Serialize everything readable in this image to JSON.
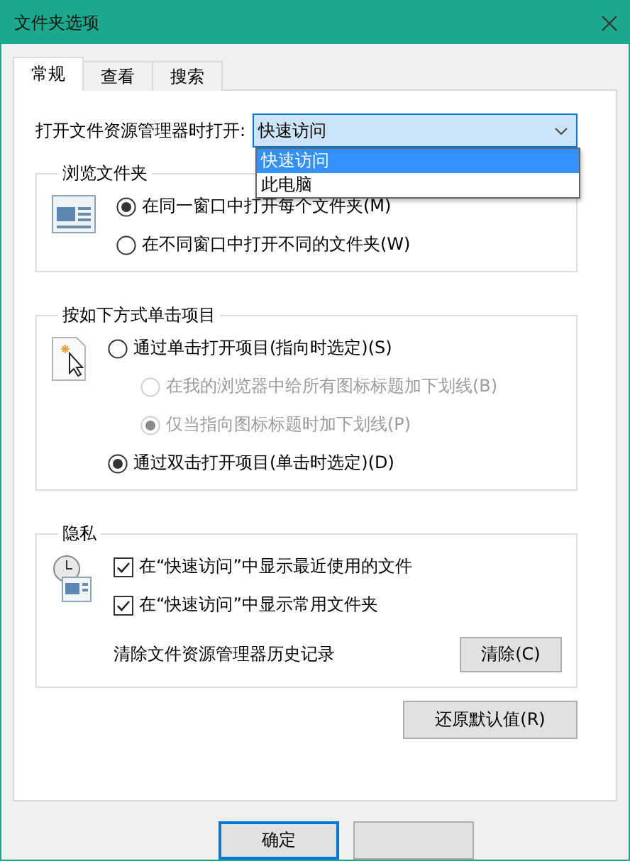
{
  "window": {
    "title": "文件夹选项"
  },
  "tabs": [
    {
      "label": "常规",
      "selected": true
    },
    {
      "label": "查看",
      "selected": false
    },
    {
      "label": "搜索",
      "selected": false
    }
  ],
  "open_with": {
    "label": "打开文件资源管理器时打开:",
    "value": "快速访问",
    "expanded": true,
    "options": [
      {
        "label": "快速访问",
        "selected": true
      },
      {
        "label": "此电脑",
        "selected": false
      }
    ]
  },
  "groups": [
    {
      "title": "浏览文件夹",
      "items": [
        {
          "kind": "radio",
          "label": "在同一窗口中打开每个文件夹(M)",
          "selected": true,
          "disabled": false
        },
        {
          "kind": "radio",
          "label": "在不同窗口中打开不同的文件夹(W)",
          "selected": false,
          "disabled": false
        }
      ]
    },
    {
      "title": "按如下方式单击项目",
      "items": [
        {
          "kind": "radio",
          "label": "通过单击打开项目(指向时选定)(S)",
          "selected": false,
          "disabled": false,
          "children": [
            {
              "kind": "radio",
              "label": "在我的浏览器中给所有图标标题加下划线(B)",
              "selected": false,
              "disabled": true
            },
            {
              "kind": "radio",
              "label": "仅当指向图标标题时加下划线(P)",
              "selected": true,
              "disabled": true
            }
          ]
        },
        {
          "kind": "radio",
          "label": "通过双击打开项目(单击时选定)(D)",
          "selected": true,
          "disabled": false
        }
      ]
    },
    {
      "title": "隐私",
      "items": [
        {
          "kind": "checkbox",
          "label": "在“快速访问”中显示最近使用的文件",
          "checked": true
        },
        {
          "kind": "checkbox",
          "label": "在“快速访问”中显示常用文件夹",
          "checked": true
        },
        {
          "kind": "action",
          "label": "清除文件资源管理器历史记录",
          "button": "清除(C)"
        }
      ]
    }
  ],
  "restore_button": "还原默认值(R)",
  "dialog_buttons": [
    {
      "kind": "text",
      "label": "确定",
      "default": true
    },
    {
      "kind": "blank",
      "default": false
    }
  ]
}
